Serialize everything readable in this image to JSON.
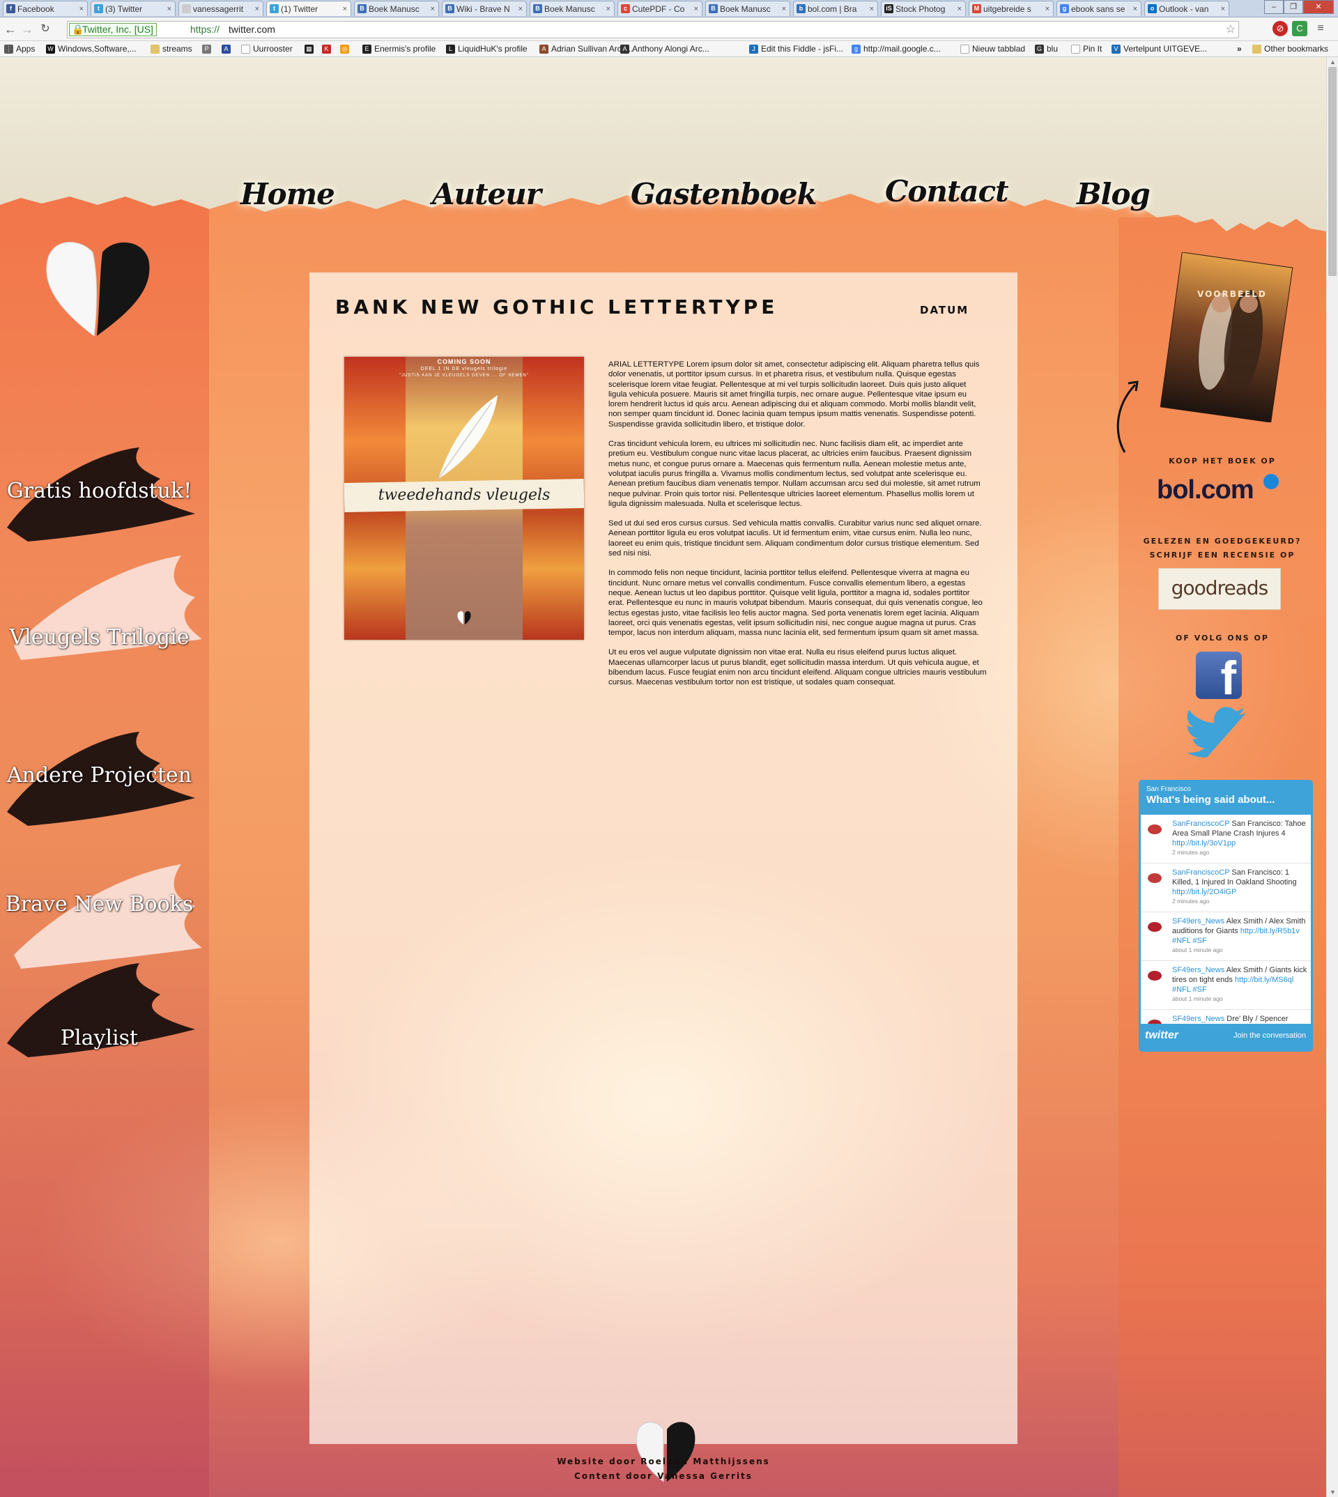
{
  "browser": {
    "tabs": [
      {
        "label": "Facebook",
        "icon": "facebook-icon",
        "color": "#3b5998",
        "glyph": "f"
      },
      {
        "label": "(3) Twitter",
        "icon": "twitter-icon",
        "color": "#3da3d9",
        "glyph": "t"
      },
      {
        "label": "vanessagerrit",
        "icon": "page-icon",
        "color": "#cccccc",
        "glyph": ""
      },
      {
        "label": "(1) Twitter",
        "icon": "twitter-icon",
        "color": "#3da3d9",
        "glyph": "t"
      },
      {
        "label": "Boek Manusc",
        "icon": "blogger-icon",
        "color": "#3f6fb5",
        "glyph": "B"
      },
      {
        "label": "Wiki - Brave N",
        "icon": "blogger-icon",
        "color": "#3f6fb5",
        "glyph": "B"
      },
      {
        "label": "Boek Manusc",
        "icon": "blogger-icon",
        "color": "#3f6fb5",
        "glyph": "B"
      },
      {
        "label": "CutePDF - Co",
        "icon": "cutepdf-icon",
        "color": "#d94a3d",
        "glyph": "c"
      },
      {
        "label": "Boek Manusc",
        "icon": "blogger-icon",
        "color": "#3f6fb5",
        "glyph": "B"
      },
      {
        "label": "bol.com | Bra",
        "icon": "bol-icon",
        "color": "#2f6fb8",
        "glyph": "b"
      },
      {
        "label": "Stock Photog",
        "icon": "istock-icon",
        "color": "#222222",
        "glyph": "iS"
      },
      {
        "label": "uitgebreide s",
        "icon": "gmail-icon",
        "color": "#d44638",
        "glyph": "M"
      },
      {
        "label": "ebook sans se",
        "icon": "google-icon",
        "color": "#4285f4",
        "glyph": "g"
      },
      {
        "label": "Outlook - van",
        "icon": "outlook-icon",
        "color": "#0072c6",
        "glyph": "o"
      }
    ],
    "ev_label": "Twitter, Inc. [US]",
    "url_scheme": "https://",
    "url_host": "twitter.com",
    "bookmarks": [
      {
        "label": "Apps",
        "icon": "apps-icon",
        "color": "#5a5a5a",
        "glyph": "⋮"
      },
      {
        "label": "Windows,Software,...",
        "icon": "windows-software-icon",
        "color": "#111111",
        "glyph": "W"
      },
      {
        "label": "streams",
        "icon": "folder-icon",
        "color": "#e2c36b",
        "glyph": ""
      },
      {
        "label": "",
        "icon": "printer-icon",
        "color": "#777777",
        "glyph": "P"
      },
      {
        "label": "",
        "icon": "a-icon",
        "color": "#2b4da0",
        "glyph": "A"
      },
      {
        "label": "Uurrooster",
        "icon": "page-icon",
        "color": "#ffffff",
        "glyph": ""
      },
      {
        "label": "",
        "icon": "qr-icon",
        "color": "#222222",
        "glyph": "▦"
      },
      {
        "label": "",
        "icon": "k-icon",
        "color": "#c62828",
        "glyph": "K"
      },
      {
        "label": "",
        "icon": "rss-icon",
        "color": "#f39c12",
        "glyph": "◎"
      },
      {
        "label": "Enermis's profile",
        "icon": "profile-icon",
        "color": "#222222",
        "glyph": "E"
      },
      {
        "label": "LiquidHuK's profile",
        "icon": "profile-icon",
        "color": "#222222",
        "glyph": "L"
      },
      {
        "label": "Adrian Sullivan Arch...",
        "icon": "arch-icon",
        "color": "#8a4b2a",
        "glyph": "A"
      },
      {
        "label": "Anthony Alongi Arc...",
        "icon": "arch-icon",
        "color": "#333333",
        "glyph": "A"
      },
      {
        "label": "Edit this Fiddle - jsFi...",
        "icon": "jsfiddle-icon",
        "color": "#1e6fb8",
        "glyph": "J"
      },
      {
        "label": "http://mail.google.c...",
        "icon": "google-icon",
        "color": "#4285f4",
        "glyph": "g"
      },
      {
        "label": "Nieuw tabblad",
        "icon": "page-icon",
        "color": "#ffffff",
        "glyph": ""
      },
      {
        "label": "blu",
        "icon": "blu-icon",
        "color": "#333333",
        "glyph": "G"
      },
      {
        "label": "Pin It",
        "icon": "page-icon",
        "color": "#ffffff",
        "glyph": ""
      },
      {
        "label": "Vertelpunt UITGEVE...",
        "icon": "vertelpunt-icon",
        "color": "#1e6fb8",
        "glyph": "V"
      }
    ],
    "bookmarks_more": "»",
    "other_bookmarks": "Other bookmarks"
  },
  "site": {
    "nav": [
      "Home",
      "Auteur",
      "Gastenboek",
      "Contact",
      "Blog"
    ],
    "left_menu": [
      {
        "label": "Gratis hoofdstuk!",
        "feather": "dark"
      },
      {
        "label": "Vleugels Trilogie",
        "feather": "light"
      },
      {
        "label": "Andere Projecten",
        "feather": "dark"
      },
      {
        "label": "Brave New Books",
        "feather": "light"
      },
      {
        "label": "Playlist",
        "feather": "dark"
      }
    ],
    "post": {
      "title": "BANK NEW GOTHIC LETTERTYPE",
      "date": "DATUM",
      "cover": {
        "top": "COMING SOON",
        "sub": "DEEL 1 IN DE vleugels trilogie",
        "tagline": "\"JUSTIS AAN JE VLEUGELS GEVEN ... OF NEMEN\"",
        "title": "tweedehands vleugels"
      },
      "paragraphs": [
        "ARIAL LETTERTYPE Lorem ipsum dolor sit amet, consectetur adipiscing elit. Aliquam pharetra tellus quis dolor venenatis, ut porttitor ipsum cursus. In et pharetra risus, et vestibulum nulla. Quisque egestas scelerisque lorem vitae feugiat. Pellentesque at mi vel turpis sollicitudin laoreet. Duis quis justo aliquet ligula vehicula posuere. Mauris sit amet fringilla turpis, nec ornare augue. Pellentesque vitae ipsum eu lorem hendrerit luctus id quis arcu. Aenean adipiscing dui et aliquam commodo. Morbi mollis blandit velit, non semper quam tincidunt id. Donec lacinia quam tempus ipsum mattis venenatis. Suspendisse potenti. Suspendisse gravida sollicitudin libero, et tristique dolor.",
        "Cras tincidunt vehicula lorem, eu ultrices mi sollicitudin nec. Nunc facilisis diam elit, ac imperdiet ante pretium eu. Vestibulum congue nunc vitae lacus placerat, ac ultricies enim faucibus. Praesent dignissim metus nunc, et congue purus ornare a. Maecenas quis fermentum nulla. Aenean molestie metus ante, volutpat iaculis purus fringilla a. Vivamus mollis condimentum lectus, sed volutpat ante scelerisque eu. Aenean pretium faucibus diam venenatis tempor. Nullam accumsan arcu sed dui molestie, sit amet rutrum neque pulvinar. Proin quis tortor nisi. Pellentesque ultricies laoreet elementum. Phasellus mollis lorem ut ligula dignissim malesuada. Nulla et scelerisque lectus.",
        "Sed ut dui sed eros cursus cursus. Sed vehicula mattis convallis. Curabitur varius nunc sed aliquet ornare. Aenean porttitor ligula eu eros volutpat iaculis. Ut id fermentum enim, vitae cursus enim. Nulla leo nunc, laoreet eu enim quis, tristique tincidunt sem. Aliquam condimentum dolor cursus tristique elementum. Sed sed nisi nisi.",
        "In commodo felis non neque tincidunt, lacinia porttitor tellus eleifend. Pellentesque viverra at magna eu tincidunt. Nunc ornare metus vel convallis condimentum. Fusce convallis elementum libero, a egestas neque. Aenean luctus ut leo dapibus porttitor. Quisque velit ligula, porttitor a magna id, sodales porttitor erat. Pellentesque eu nunc in mauris volutpat bibendum. Mauris consequat, dui quis venenatis congue, leo lectus egestas justo, vitae facilisis leo felis auctor magna. Sed porta venenatis lorem eget lacinia. Aliquam laoreet, orci quis venenatis egestas, velit ipsum sollicitudin nisi, nec congue augue magna ut purus. Cras tempor, lacus non interdum aliquam, massa nunc lacinia elit, sed fermentum ipsum quam sit amet massa.",
        "Ut eu eros vel augue vulputate dignissim non vitae erat. Nulla eu risus eleifend purus luctus aliquet. Maecenas ullamcorper lacus ut purus blandit, eget sollicitudin massa interdum. Ut quis vehicula augue, et bibendum lacus. Fusce feugiat enim non arcu tincidunt eleifend. Aliquam congue ultricies mauris vestibulum cursus. Maecenas vestibulum tortor non est tristique, ut sodales quam consequat."
      ]
    },
    "sidebar": {
      "book_badge": "VOORBEELD",
      "buy_label": "KOOP HET BOEK OP",
      "bol_logo": "bol.com",
      "review_line1": "GELEZEN EN GOEDGEKEURD?",
      "review_line2": "SCHRIJF EEN RECENSIE OP",
      "goodreads": "goodreads",
      "follow_label": "OF VOLG ONS OP",
      "facebook_glyph": "f"
    },
    "twitter_widget": {
      "location": "San Francisco",
      "heading": "What's being said about...",
      "tweets": [
        {
          "user": "SanFranciscoCP",
          "text": "San Francisco: Tahoe Area Small Plane Crash Injures 4",
          "link": "http://bit.ly/3oV1pp",
          "time": "2 minutes ago",
          "avatar": "sf-logo-icon"
        },
        {
          "user": "SanFranciscoCP",
          "text": "San Francisco: 1 Killed, 1 Injured In Oakland Shooting",
          "link": "http://bit.ly/2O4iGP",
          "time": "2 minutes ago",
          "avatar": "sf-logo-icon"
        },
        {
          "user": "SF49ers_News",
          "text": "Alex Smith / Alex Smith auditions for Giants",
          "link": "http://bit.ly/R5b1v #NFL #SF",
          "time": "about 1 minute ago",
          "avatar": "49ers-logo-icon"
        },
        {
          "user": "SF49ers_News",
          "text": "Alex Smith / Giants kick tires on tight ends",
          "link": "http://bit.ly/MS6ql #NFL #SF",
          "time": "about 1 minute ago",
          "avatar": "49ers-logo-icon"
        },
        {
          "user": "SF49ers_News",
          "text": "Dre' Bly / Spencer",
          "link": "",
          "time": "",
          "avatar": "49ers-logo-icon"
        }
      ],
      "logo": "twitter",
      "join": "Join the conversation"
    },
    "footer": {
      "line1": "Website  door Roeland Matthijssens",
      "line2": "Content door Vanessa Gerrits"
    }
  }
}
